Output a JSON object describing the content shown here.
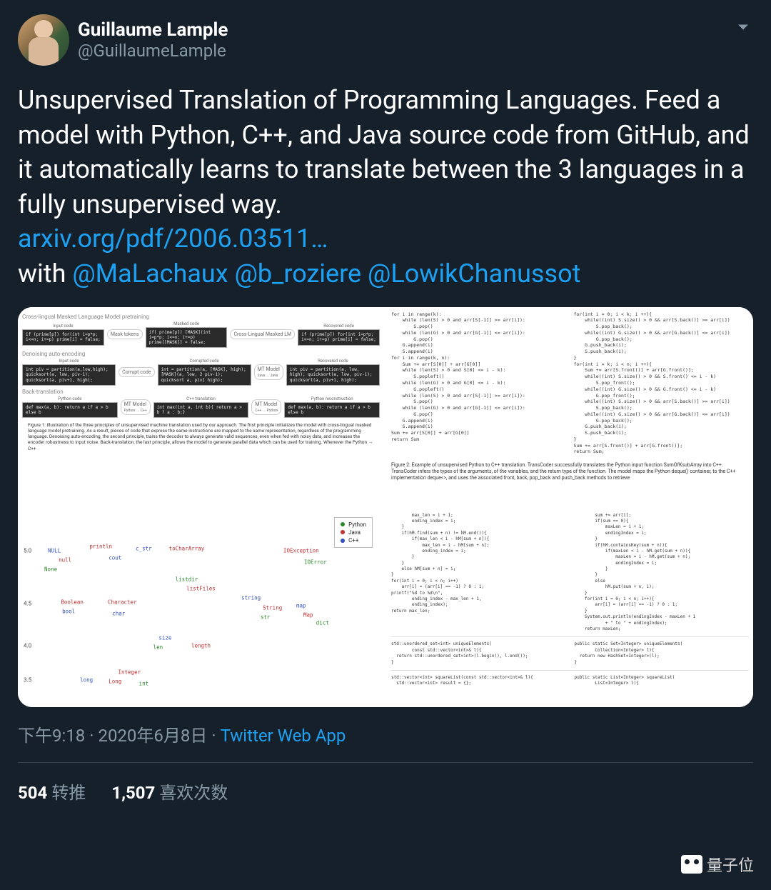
{
  "author": {
    "display_name": "Guillaume Lample",
    "handle": "@GuillaumeLample"
  },
  "body": {
    "text_line1": "Unsupervised Translation of Programming Languages. Feed a model with Python, C++, and Java source code from GitHub, and it automatically learns to translate between the 3 languages in a fully unsupervised way.",
    "link_text": "arxiv.org/pdf/2006.03511…",
    "with_prefix": "with ",
    "mention1": "@MaLachaux",
    "mention2": "@b_roziere",
    "mention3": "@LowikChanussot"
  },
  "figure1": {
    "section1": "Cross-lingual Masked Language Model pretraining",
    "section2": "Denoising auto-encoding",
    "section3": "Back-translation",
    "lbl_input": "Input code",
    "lbl_masked": "Masked code",
    "lbl_recovered": "Recovered code",
    "lbl_corrupt": "Corrupted code",
    "lbl_python": "Python code",
    "lbl_cpp": "C++ translation",
    "lbl_pyrec": "Python reconstruction",
    "arrow_mask": "Mask tokens",
    "arrow_xlm": "Cross-Lingual Masked LM",
    "arrow_corrupt": "Corrupt code",
    "arrow_mt": "MT Model",
    "arrow_mt_jj": "Java → Java",
    "arrow_mt_pc": "Python → C++",
    "arrow_mt_cp": "C++ → Python",
    "code_in1": "if (prime[p])\n  for(int i=p*p; i<=n; i+=p)\n    prime[i] = false;",
    "code_mask1": "if( prime[p])\n  [MASK](int i=p*p; i<=n; i+=p)\n    prime[[MASK]] = false;",
    "code_rec1": "if (prime[p])\n  for(int i=p*p; i<=n; i+=p)\n    prime[i] = false;",
    "code_in2": "int piv = partition(a,low,high);\nquicksort(a, low, piv-1);\nquicksort(a, piv+1, high);",
    "code_cor2": "int = partition(a, [MASK], high);\n[MASK](a, low, 2 piv-1);\nquicksort a, piv] high);",
    "code_rec2": "int piv = partition(a, low, high);\nquicksort(a, low, piv-1);\nquicksort(a, piv+1, high);",
    "code_py3": "def max(a, b):\n  return a if a > b else b",
    "code_cpp3": "int max(int a, int b){\n  return a > b ? a : b;}",
    "code_pyr3": "def max(a, b):\n  return a if a > b else b",
    "caption": "Figure 1: Illustration of the three principles of unsupervised machine translation used by our approach. The first principle initializes the model with cross-lingual masked language model pretraining. As a result, pieces of code that express the same instructions are mapped to the same representation, regardless of the programming language. Denoising auto-encoding, the second principle, trains the decoder to always generate valid sequences, even when fed with noisy data, and increases the encoder robustness to input noise. Back-translation, the last principle, allows the model to generate parallel data which can be used for training. Whenever the Python → C++"
  },
  "figure2": {
    "left_code": "for i in range(k):\n    while (len(S) > 0 and arr[S[-1]] >= arr[i]):\n        S.pop()\n    while (len(G) > 0 and arr[G[-1]] <= arr[i]):\n        G.pop()\n    G.append(i)\n    S.append(i)\nfor i in range(k, n):\n    Sum += arr[S[0]] + arr[G[0]]\n    while (len(S) > 0 and S[0] <= i - k):\n        S.popleft()\n    while (len(G) > 0 and G[0] <= i - k):\n        G.popleft()\n    while (len(S) > 0 and arr[S[-1]] >= arr[i]):\n        S.pop()\n    while (len(G) > 0 and arr[G[-1]] <= arr[i]):\n        G.pop()\n    G.append(i)\n    S.append(i)\nSum += arr[S[0]] + arr[G[0]]\nreturn Sum",
    "right_code": "for(int i = 0; i < k; i ++){\n    while((int) S.size() > 0 && arr[S.back()] >= arr[i])\n        S.pop_back();\n    while((int) G.size() > 0 && arr[G.back()] <= arr[i])\n        G.pop_back();\n    G.push_back(i);\n    S.push_back(i);\n}\nfor(int i = k; i < n; i ++){\n    Sum += arr[S.front()] + arr[G.front()];\n    while((int) S.size() > 0 && S.front() <= i - k)\n        S.pop_front();\n    while((int) G.size() > 0 && G.front() <= i - k)\n        G.pop_front();\n    while((int) S.size() > 0 && arr[S.back()] >= arr[i])\n        S.pop_back();\n    while((int) G.size() > 0 && arr[G.back()] <= arr[i])\n        G.pop_back();\n    G.push_back(i);\n    S.push_back(i);\n}\nSum += arr[S.front()] + arr[G.front()];\nreturn Sum;",
    "caption": "Figure 2: Example of unsupervised Python to C++ translation. TransCoder successfully translates the Python input function SumOfKsubArray into C++. TransCoder infers the types of the arguments, of the variables, and the return type of the function. The model maps the Python deque() container, to the C++ implementation deque<>, and uses the associated front, back, pop_back and push_back methods to retrieve"
  },
  "scatter": {
    "yticks": [
      "5.0",
      "4.5",
      "4.0",
      "3.5"
    ],
    "legend": {
      "python": "Python",
      "java": "Java",
      "cpp": "C++"
    },
    "words": [
      {
        "t": "NULL",
        "c": "cp",
        "x": 9,
        "y": 20
      },
      {
        "t": "null",
        "c": "jv",
        "x": 12,
        "y": 25
      },
      {
        "t": "None",
        "c": "py",
        "x": 8,
        "y": 30
      },
      {
        "t": "println",
        "c": "jv",
        "x": 22,
        "y": 18
      },
      {
        "t": "cout",
        "c": "cp",
        "x": 26,
        "y": 24
      },
      {
        "t": "c_str",
        "c": "cp",
        "x": 34,
        "y": 19
      },
      {
        "t": "toCharArray",
        "c": "jv",
        "x": 46,
        "y": 19
      },
      {
        "t": "listdir",
        "c": "py",
        "x": 46,
        "y": 35
      },
      {
        "t": "listFiles",
        "c": "jv",
        "x": 50,
        "y": 40
      },
      {
        "t": "IOException",
        "c": "jv",
        "x": 78,
        "y": 20
      },
      {
        "t": "IOError",
        "c": "py",
        "x": 82,
        "y": 26
      },
      {
        "t": "Boolean",
        "c": "jv",
        "x": 14,
        "y": 47
      },
      {
        "t": "bool",
        "c": "cp",
        "x": 13,
        "y": 52
      },
      {
        "t": "Character",
        "c": "jv",
        "x": 28,
        "y": 47
      },
      {
        "t": "char",
        "c": "cp",
        "x": 27,
        "y": 53
      },
      {
        "t": "string",
        "c": "cp",
        "x": 64,
        "y": 45
      },
      {
        "t": "String",
        "c": "jv",
        "x": 70,
        "y": 50
      },
      {
        "t": "str",
        "c": "py",
        "x": 68,
        "y": 55
      },
      {
        "t": "map",
        "c": "cp",
        "x": 78,
        "y": 49
      },
      {
        "t": "Map",
        "c": "jv",
        "x": 80,
        "y": 54
      },
      {
        "t": "dict",
        "c": "py",
        "x": 84,
        "y": 58
      },
      {
        "t": "size",
        "c": "cp",
        "x": 40,
        "y": 66
      },
      {
        "t": "len",
        "c": "py",
        "x": 38,
        "y": 71
      },
      {
        "t": "length",
        "c": "jv",
        "x": 50,
        "y": 70
      },
      {
        "t": "Integer",
        "c": "jv",
        "x": 30,
        "y": 84
      },
      {
        "t": "long",
        "c": "cp",
        "x": 18,
        "y": 88
      },
      {
        "t": "Long",
        "c": "jv",
        "x": 26,
        "y": 89
      },
      {
        "t": "int",
        "c": "py",
        "x": 34,
        "y": 90
      }
    ]
  },
  "figure4": {
    "left_a": "        max_len = i + 1;\n        ending_index = i;\n    }\n    if(hM.find(sum + n) != hM.end()){\n        if(max_len < i - hM[sum + n]){\n            max_len = i - hM[sum + n];\n            ending_index = i;\n        }\n    }\n    else hM[sum + n] = i;\n}\nfor(int i = 0; i < n; i++)\n    arr[i] = (arr[i] == -1) ? 0 : 1;\nprintf(\"%d to %d\\n\",\n        ending_index - max_len + 1,\n        ending_index);\nreturn max_len;",
    "right_a": "        sum += arr[i];\n        if(sum == 0){\n            maxLen = i + 1;\n            endingIndex = i;\n        }\n        if(hM.containsKey(sum + n)){\n            if(maxLen < i - hM.get(sum + n)){\n                maxLen = i - hM.get(sum + n);\n                endingIndex = i;\n            }\n        }\n        else\n            hM.put(sum + n, i);\n    }\n    for(int i = 0; i < n; i++){\n        arr[i] = (arr[i] == -1) ? 0 : 1;\n    }\n    System.out.println(endingIndex - maxLen + 1\n            + \" to \" + endingIndex);\n    return maxLen;",
    "left_b": "std::unordered_set<int> uniqueElements(\n        const std::vector<int>& l){\n  return std::unordered_set<int>(l.begin(), l.end());\n}",
    "right_b": "public static Set<Integer> uniqueElements(\n        Collection<Integer> l){\n  return new HashSet<Integer>(l);\n}",
    "left_c": "std::vector<int> squareList(const std::vector<int>& l){\n  std::vector<int> result = {};",
    "right_c": "public static List<Integer> squareList(\n        List<Integer> l){"
  },
  "meta": {
    "time": "下午9:18",
    "sep1": " · ",
    "date": "2020年6月8日",
    "sep2": " · ",
    "source": "Twitter Web App"
  },
  "stats": {
    "retweets_count": "504",
    "retweets_label": "转推",
    "likes_count": "1,507",
    "likes_label": "喜欢次数"
  },
  "watermark": "量子位"
}
